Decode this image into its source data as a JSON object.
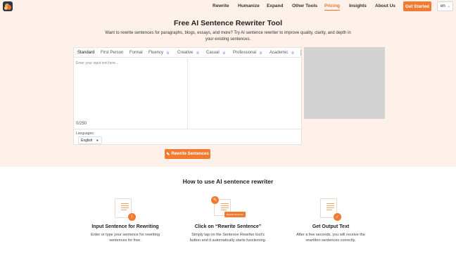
{
  "nav": {
    "links": [
      "Rewrite",
      "Humanize",
      "Expand",
      "Other Tools",
      "Pricing",
      "Insights",
      "About Us"
    ],
    "cta_label": "Get Started",
    "lang": "en"
  },
  "hero": {
    "title": "Free AI Sentence Rewriter Tool",
    "subtitle": "Want to rewrite sentences for paragraphs, blogs, essays, and more? Try AI sentence rewriter to improve quality, clarity, and depth in your existing sentences."
  },
  "tool": {
    "tabs": [
      "Standard",
      "First Person",
      "Formal",
      "Fluency",
      "Creative",
      "Casual",
      "Professional",
      "Academic"
    ],
    "input_placeholder": "Enter your input text here...",
    "char_count": "0/250",
    "language_label": "Languages:",
    "language_value": "English",
    "rewrite_button": "Rewrite Sentences"
  },
  "how": {
    "title": "How to use AI sentence rewriter",
    "pill_label": "Rewrite Sentence",
    "steps": [
      {
        "title": "Input Sentence for Rewriting",
        "desc": "Enter or type your sentence for rewriting sentences for free."
      },
      {
        "title": "Click on “Rewrite Sentence”",
        "desc": "Simply tap on the Sentence Rewriter tool’s button and it automatically starts functioning."
      },
      {
        "title": "Get Output Text",
        "desc": "After a few seconds, you will receive the rewritten sentences correctly."
      }
    ]
  },
  "colors": {
    "accent": "#f07b31",
    "crown": "#8b2fc9",
    "bg": "#fdf1ea"
  }
}
